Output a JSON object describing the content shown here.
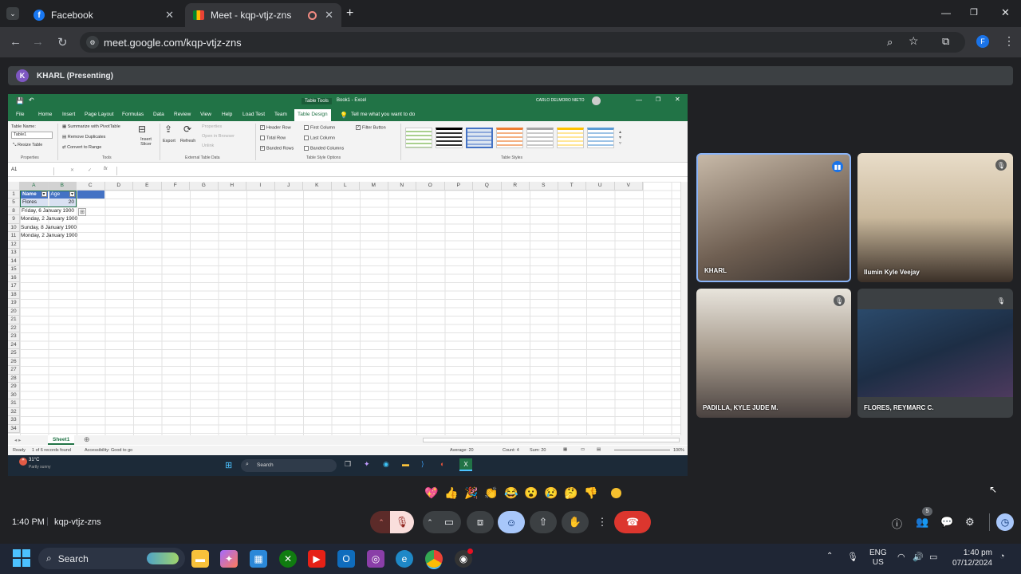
{
  "browser": {
    "tabs": [
      {
        "label": "Facebook",
        "icon": "facebook-icon"
      },
      {
        "label": "Meet - kqp-vtjz-zns",
        "icon": "meet-icon"
      }
    ],
    "url": "meet.google.com/kqp-vtjz-zns",
    "profile_initial": "F"
  },
  "meet": {
    "presenting_banner": "KHARL (Presenting)",
    "presenter_initial": "K",
    "participants": [
      {
        "name": "KHARL"
      },
      {
        "name": "Ilumin Kyle Veejay"
      },
      {
        "name": "PADILLA, KYLE JUDE M."
      },
      {
        "name": "FLORES, REYMARC C."
      }
    ],
    "reactions": [
      "💖",
      "👍",
      "🎉",
      "👏",
      "😂",
      "😮",
      "😢",
      "🤔",
      "👎"
    ],
    "time": "1:40 PM",
    "meeting_code": "kqp-vtjz-zns",
    "people_count": "5"
  },
  "excel": {
    "title_tools": "Table Tools",
    "title_book": "Book1 - Excel",
    "user": "CARLO DELMORO NIETO",
    "ribbon_tabs": [
      "File",
      "Home",
      "Insert",
      "Page Layout",
      "Formulas",
      "Data",
      "Review",
      "View",
      "Help",
      "Load Test",
      "Team",
      "Table Design"
    ],
    "tell_me": "Tell me what you want to do",
    "table_name_label": "Table Name:",
    "table_name": "Table1",
    "resize_table": "Resize Table",
    "properties_group": "Properties",
    "tools_items": [
      "Summarize with PivotTable",
      "Remove Duplicates",
      "Convert to Range"
    ],
    "tools_group": "Tools",
    "insert_slicer": "Insert Slicer",
    "export": "Export",
    "refresh": "Refresh",
    "ext_items": [
      "Properties",
      "Open in Browser",
      "Unlink"
    ],
    "ext_group": "External Table Data",
    "style_options": [
      "Header Row",
      "Total Row",
      "Banded Rows",
      "First Column",
      "Last Column",
      "Banded Columns",
      "Filter Button"
    ],
    "style_options_group": "Table Style Options",
    "table_styles_group": "Table Styles",
    "namebox": "A1",
    "columns": [
      "A",
      "B",
      "C",
      "D",
      "E",
      "F",
      "G",
      "H",
      "I",
      "J",
      "K",
      "L",
      "M",
      "N",
      "O",
      "P",
      "Q",
      "R",
      "S",
      "T",
      "U",
      "V"
    ],
    "rows": [
      "1",
      "5",
      "8",
      "9",
      "10",
      "11",
      "12",
      "13",
      "14",
      "15",
      "16",
      "17",
      "18",
      "19",
      "20",
      "21",
      "22",
      "23",
      "24",
      "25",
      "26",
      "27",
      "28",
      "29",
      "30",
      "31",
      "32",
      "33",
      "34"
    ],
    "header_name": "Name",
    "header_age": "Age",
    "row5_name": "Flores",
    "row5_age": "20",
    "dates": [
      "Friday, 6 January 1900",
      "Monday, 2 January 1900",
      "Sunday, 8 January 1900",
      "Monday, 2 January 1900"
    ],
    "sheet_tab": "Sheet1",
    "status_ready": "Ready",
    "status_records": "1 of 6 records found",
    "status_access": "Accessibility: Good to go",
    "status_avg": "Average: 20",
    "status_count": "Count: 4",
    "status_sum": "Sum: 20",
    "zoom": "100%",
    "inner_weather_temp": "31°C",
    "inner_weather_desc": "Partly sunny",
    "inner_search": "Search"
  },
  "taskbar": {
    "search": "Search",
    "lang1": "ENG",
    "lang2": "US",
    "clock_time": "1:40 pm",
    "clock_date": "07/12/2024"
  }
}
